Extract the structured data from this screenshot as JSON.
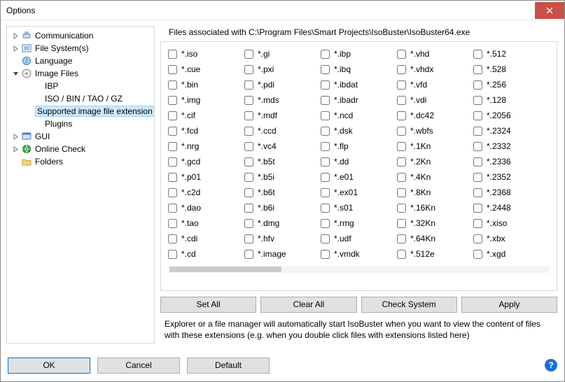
{
  "window": {
    "title": "Options"
  },
  "tree": {
    "items": [
      {
        "id": "communication",
        "label": "Communication",
        "indent": 0,
        "tw": "right",
        "icon": "comm",
        "sel": false
      },
      {
        "id": "filesystem",
        "label": "File System(s)",
        "indent": 0,
        "tw": "right",
        "icon": "fs",
        "sel": false
      },
      {
        "id": "language",
        "label": "Language",
        "indent": 0,
        "tw": "blank",
        "icon": "lang",
        "sel": false
      },
      {
        "id": "imagefiles",
        "label": "Image Files",
        "indent": 0,
        "tw": "down",
        "icon": "img",
        "sel": false
      },
      {
        "id": "ibp",
        "label": "IBP",
        "indent": 1,
        "tw": "blank",
        "icon": "none",
        "sel": false
      },
      {
        "id": "iso",
        "label": "ISO / BIN / TAO / GZ",
        "indent": 1,
        "tw": "blank",
        "icon": "none",
        "sel": false
      },
      {
        "id": "supported",
        "label": "Supported image file extension",
        "indent": 1,
        "tw": "blank",
        "icon": "none",
        "sel": true
      },
      {
        "id": "plugins",
        "label": "Plugins",
        "indent": 1,
        "tw": "blank",
        "icon": "none",
        "sel": false
      },
      {
        "id": "gui",
        "label": "GUI",
        "indent": 0,
        "tw": "right",
        "icon": "gui",
        "sel": false
      },
      {
        "id": "online",
        "label": "Online Check",
        "indent": 0,
        "tw": "right",
        "icon": "online",
        "sel": false
      },
      {
        "id": "folders",
        "label": "Folders",
        "indent": 0,
        "tw": "blank",
        "icon": "folder",
        "sel": false
      }
    ]
  },
  "main": {
    "assoc_label": "Files associated with C:\\Program Files\\Smart Projects\\IsoBuster\\IsoBuster64.exe",
    "columns": [
      [
        "*.iso",
        "*.cue",
        "*.bin",
        "*.img",
        "*.cif",
        "*.fcd",
        "*.nrg",
        "*.gcd",
        "*.p01",
        "*.c2d",
        "*.dao",
        "*.tao",
        "*.cdi",
        "*.cd"
      ],
      [
        "*.gi",
        "*.pxi",
        "*.pdi",
        "*.mds",
        "*.mdf",
        "*.ccd",
        "*.vc4",
        "*.b5t",
        "*.b5i",
        "*.b6t",
        "*.b6i",
        "*.dmg",
        "*.hfv",
        "*.image"
      ],
      [
        "*.ibp",
        "*.ibq",
        "*.ibdat",
        "*.ibadr",
        "*.ncd",
        "*.dsk",
        "*.flp",
        "*.dd",
        "*.e01",
        "*.ex01",
        "*.s01",
        "*.rmg",
        "*.udf",
        "*.vmdk"
      ],
      [
        "*.vhd",
        "*.vhdx",
        "*.vfd",
        "*.vdi",
        "*.dc42",
        "*.wbfs",
        "*.1Kn",
        "*.2Kn",
        "*.4Kn",
        "*.8Kn",
        "*.16Kn",
        "*.32Kn",
        "*.64Kn",
        "*.512e"
      ],
      [
        "*.512",
        "*.528",
        "*.256",
        "*.128",
        "*.2056",
        "*.2324",
        "*.2332",
        "*.2336",
        "*.2352",
        "*.2368",
        "*.2448",
        "*.xiso",
        "*.xbx",
        "*.xgd"
      ]
    ],
    "buttons": {
      "set_all": "Set All",
      "clear_all": "Clear All",
      "check_system": "Check System",
      "apply": "Apply"
    },
    "explainer": "Explorer or a file manager will automatically start IsoBuster when you want to view the content of files with these extensions (e.g. when you double click files with extensions listed here)"
  },
  "footer": {
    "ok": "OK",
    "cancel": "Cancel",
    "default": "Default"
  }
}
